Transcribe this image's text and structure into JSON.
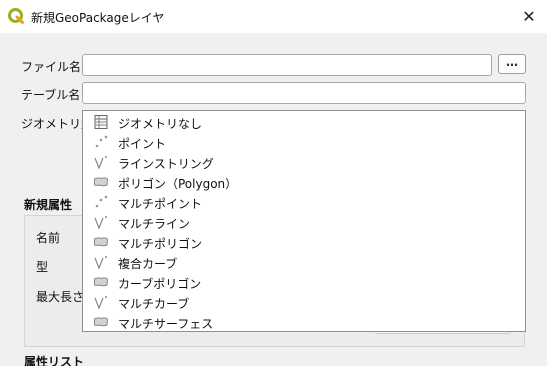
{
  "window": {
    "title": "新規GeoPackageレイヤ",
    "close_glyph": "✕",
    "app_icon": "qgis-logo-icon"
  },
  "form": {
    "file_label": "ファイル名",
    "file_value": "",
    "browse_label": "…",
    "table_label": "テーブル名",
    "table_value": "",
    "geometry_label": "ジオメトリ型"
  },
  "geometry_options": [
    {
      "label": "ジオメトリなし",
      "icon": "table-icon"
    },
    {
      "label": "ポイント",
      "icon": "point-icon"
    },
    {
      "label": "ラインストリング",
      "icon": "line-icon"
    },
    {
      "label": "ポリゴン（Polygon）",
      "icon": "polygon-icon"
    },
    {
      "label": "マルチポイント",
      "icon": "point-icon"
    },
    {
      "label": "マルチライン",
      "icon": "line-icon"
    },
    {
      "label": "マルチポリゴン",
      "icon": "polygon-icon"
    },
    {
      "label": "複合カーブ",
      "icon": "line-icon"
    },
    {
      "label": "カーブポリゴン",
      "icon": "polygon-icon"
    },
    {
      "label": "マルチカーブ",
      "icon": "line-icon"
    },
    {
      "label": "マルチサーフェス",
      "icon": "polygon-icon"
    }
  ],
  "new_attribute": {
    "section_title": "新規属性",
    "name_label": "名前",
    "type_label": "型",
    "max_length_label": "最大長さ"
  },
  "attribute_list": {
    "section_title": "属性リスト"
  },
  "colors": {
    "accent": "#93b023",
    "title_bg": "#ffffff",
    "dialog_bg": "#f0f0f0"
  }
}
